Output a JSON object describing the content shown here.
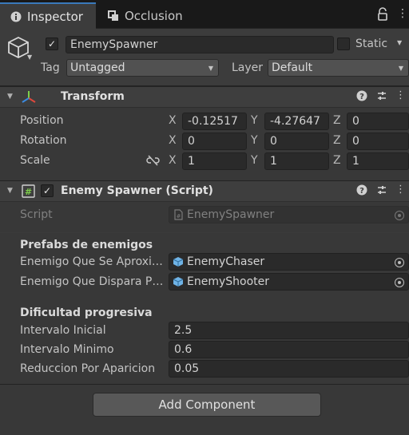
{
  "tabs": [
    {
      "label": "Inspector",
      "icon": "info-icon"
    },
    {
      "label": "Occlusion",
      "icon": "occlusion-icon"
    }
  ],
  "gameobject": {
    "active": true,
    "name": "EnemySpawner",
    "static_label": "Static",
    "static": false,
    "tag_label": "Tag",
    "tag_value": "Untagged",
    "layer_label": "Layer",
    "layer_value": "Default"
  },
  "transform": {
    "title": "Transform",
    "rows": [
      {
        "label": "Position",
        "x": "-0.12517",
        "y": "-4.27647",
        "z": "0"
      },
      {
        "label": "Rotation",
        "x": "0",
        "y": "0",
        "z": "0"
      },
      {
        "label": "Scale",
        "x": "1",
        "y": "1",
        "z": "1"
      }
    ],
    "axis_labels": [
      "X",
      "Y",
      "Z"
    ]
  },
  "spawner": {
    "title": "Enemy Spawner (Script)",
    "enabled": true,
    "script_label": "Script",
    "script_value": "EnemySpawner",
    "section1": "Prefabs de enemigos",
    "prefabs": [
      {
        "label": "Enemigo Que Se Aproxi…",
        "value": "EnemyChaser"
      },
      {
        "label": "Enemigo Que Dispara P…",
        "value": "EnemyShooter"
      }
    ],
    "section2": "Dificultad progresiva",
    "params": [
      {
        "label": "Intervalo Inicial",
        "value": "2.5"
      },
      {
        "label": "Intervalo Minimo",
        "value": "0.6"
      },
      {
        "label": "Reduccion Por Aparicion",
        "value": "0.05"
      }
    ]
  },
  "add_component": "Add Component",
  "colors": {
    "accent": "#3a79bb",
    "background": "#383838",
    "prefab_blue": "#6fb3e6"
  }
}
